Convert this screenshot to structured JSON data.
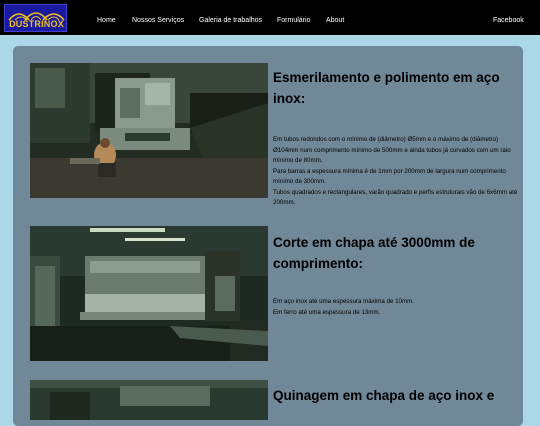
{
  "brand": {
    "name": "DUSTRINOX"
  },
  "nav": {
    "home": "Home",
    "services": "Nossos Serviços",
    "gallery": "Galeria de trabalhos",
    "form": "Formulário",
    "about": "About",
    "facebook": "Facebook"
  },
  "sections": [
    {
      "title": "Esmerilamento e polimento em aço inox:",
      "lines": [
        "Em tubos redondos com o mínimo de (diâmetro) Ø5mm e o máximo de (diâmetro) Ø104mm num comprimento mínimo de 500mm e ainda tubos já curvados com um raio mínimo de 80mm.",
        "Para barras a espessura mínima é de 1mm por 200mm de largura num comprimento mínimo de 300mm.",
        "Tubos quadrados e rectangulares, varão quadrado e perfis estruturais vão de 6x6mm até 200mm."
      ]
    },
    {
      "title": "Corte em chapa até 3000mm de comprimento:",
      "lines": [
        "Em aço inox até uma espessura máxima de 10mm.",
        "Em ferro até uma espessura de 13mm."
      ]
    },
    {
      "title": "Quinagem em chapa de aço inox e"
    }
  ],
  "colors": {
    "page_background": "#aad8e6",
    "navbar": "#000000",
    "card": "#708898",
    "logo_background": "#1a1aa0",
    "logo_text": "#f3c21a"
  }
}
